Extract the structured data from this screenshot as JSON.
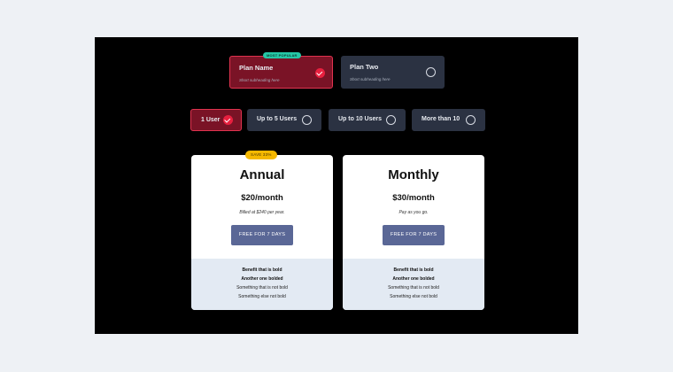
{
  "plans": [
    {
      "name": "Plan Name",
      "subheading": "Short subheading here",
      "badge": "MOST POPULAR",
      "selected": true
    },
    {
      "name": "Plan Two",
      "subheading": "Short subheading here",
      "selected": false
    }
  ],
  "user_options": [
    {
      "label": "1 User",
      "selected": true
    },
    {
      "label": "Up to 5 Users",
      "selected": false
    },
    {
      "label": "Up to 10 Users",
      "selected": false
    },
    {
      "label": "More than 10",
      "selected": false
    }
  ],
  "pricing": [
    {
      "title": "Annual",
      "badge": "SAVE 33%",
      "price": "$20/month",
      "note": "Billed at $240 per year.",
      "cta": "FREE FOR 7 DAYS",
      "benefits": [
        "Benefit that is bold",
        "Another one bolded",
        "Something that is not bold",
        "Something else not bold"
      ]
    },
    {
      "title": "Monthly",
      "price": "$30/month",
      "note": "Pay as you go.",
      "cta": "FREE FOR 7 DAYS",
      "benefits": [
        "Benefit that is bold",
        "Another one bolded",
        "Something that is not bold",
        "Something else not bold"
      ]
    }
  ],
  "colors": {
    "accent": "#e8203f",
    "selected_bg": "#7a1326",
    "option_bg": "#2b3242",
    "popular_badge": "#25c7a6",
    "save_badge": "#f5b800",
    "cta_bg": "#5a6796"
  },
  "icons": {
    "selected": "check-circle-icon",
    "unselected": "radio-ring-icon"
  }
}
